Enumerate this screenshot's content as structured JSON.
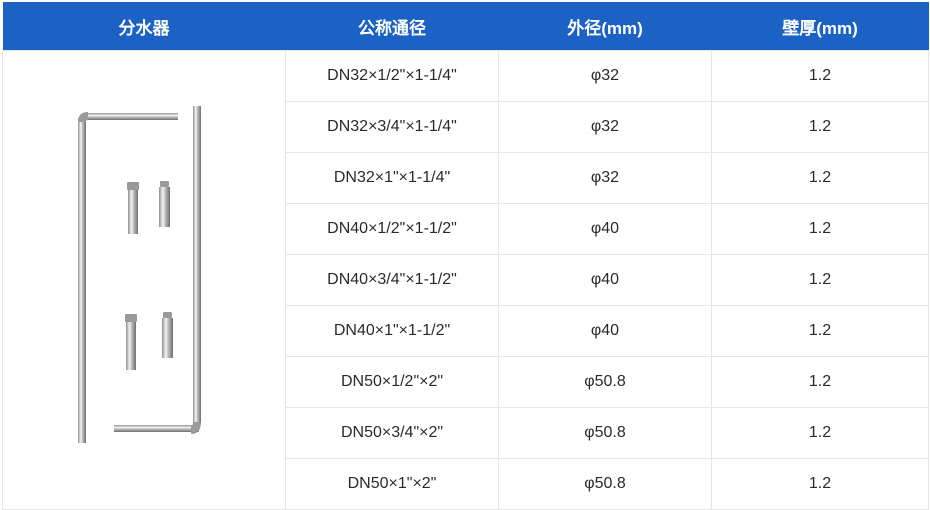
{
  "table": {
    "headers": [
      "分水器",
      "公称通径",
      "外径(mm)",
      "壁厚(mm)"
    ],
    "rows": [
      {
        "nominal": "DN32×1/2\"×1-1/4\"",
        "outer_diameter": "φ32",
        "wall": "1.2"
      },
      {
        "nominal": "DN32×3/4\"×1-1/4\"",
        "outer_diameter": "φ32",
        "wall": "1.2"
      },
      {
        "nominal": "DN32×1\"×1-1/4\"",
        "outer_diameter": "φ32",
        "wall": "1.2"
      },
      {
        "nominal": "DN40×1/2\"×1-1/2\"",
        "outer_diameter": "φ40",
        "wall": "1.2"
      },
      {
        "nominal": "DN40×3/4\"×1-1/2\"",
        "outer_diameter": "φ40",
        "wall": "1.2"
      },
      {
        "nominal": "DN40×1\"×1-1/2\"",
        "outer_diameter": "φ40",
        "wall": "1.2"
      },
      {
        "nominal": "DN50×1/2\"×2\"",
        "outer_diameter": "φ50.8",
        "wall": "1.2"
      },
      {
        "nominal": "DN50×3/4\"×2\"",
        "outer_diameter": "φ50.8",
        "wall": "1.2"
      },
      {
        "nominal": "DN50×1\"×2\"",
        "outer_diameter": "φ50.8",
        "wall": "1.2"
      }
    ]
  },
  "colors": {
    "header_bg": "#1b62c4",
    "header_text": "#ffffff",
    "border": "#e6e6e6"
  }
}
